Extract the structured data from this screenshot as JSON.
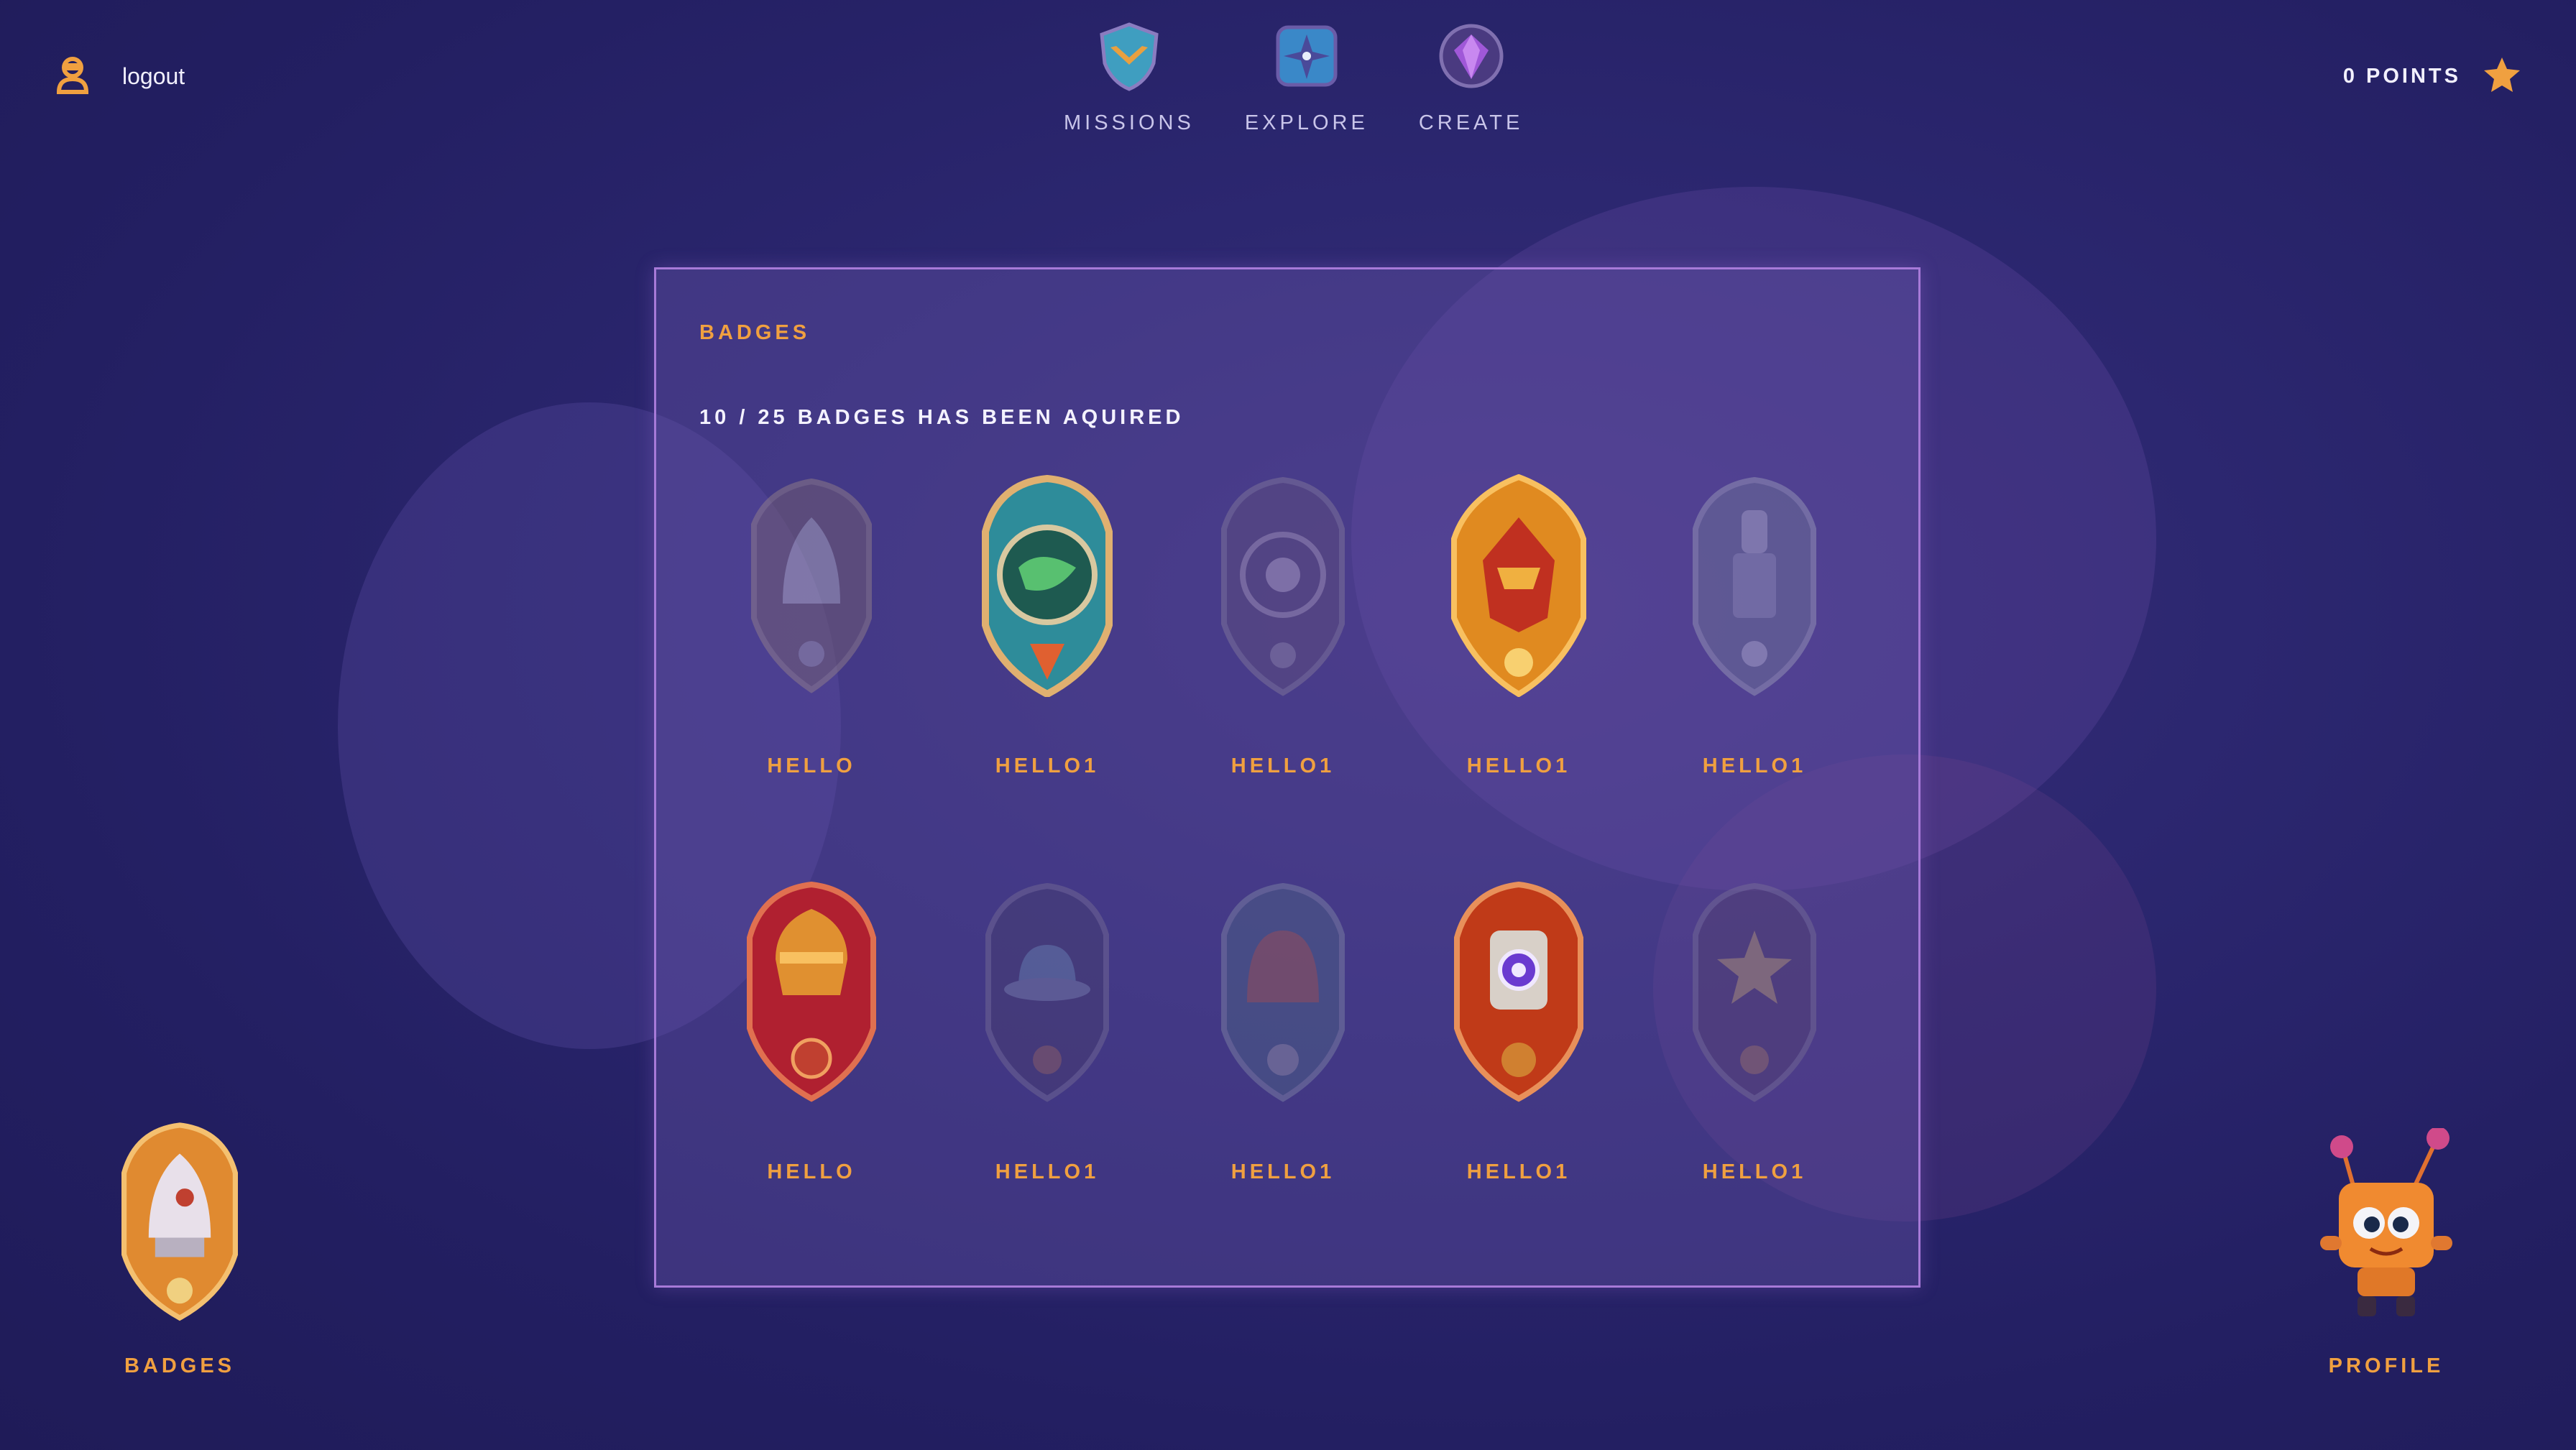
{
  "header": {
    "logout_label": "logout",
    "nav": [
      {
        "label": "MISSIONS",
        "icon": "shield-wings-icon"
      },
      {
        "label": "EXPLORE",
        "icon": "compass-star-icon"
      },
      {
        "label": "CREATE",
        "icon": "gem-icon"
      }
    ],
    "points_label": "0 POINTS"
  },
  "badges_panel": {
    "title": "BADGES",
    "summary": "10 / 25 BADGES HAS BEEN AQUIRED",
    "badges": [
      {
        "label": "HELLO",
        "acquired": false,
        "icon": "rocket-badge-icon"
      },
      {
        "label": "HELLO1",
        "acquired": true,
        "icon": "planet-badge-icon"
      },
      {
        "label": "HELLO1",
        "acquired": false,
        "icon": "orbit-badge-icon"
      },
      {
        "label": "HELLO1",
        "acquired": true,
        "icon": "ship-badge-icon"
      },
      {
        "label": "HELLO1",
        "acquired": false,
        "icon": "tower-badge-icon"
      },
      {
        "label": "HELLO",
        "acquired": true,
        "icon": "helmet-badge-icon"
      },
      {
        "label": "HELLO1",
        "acquired": false,
        "icon": "ufo-badge-icon"
      },
      {
        "label": "HELLO1",
        "acquired": false,
        "icon": "dome-badge-icon"
      },
      {
        "label": "HELLO1",
        "acquired": true,
        "icon": "robot-badge-icon"
      },
      {
        "label": "HELLO1",
        "acquired": false,
        "icon": "star-badge-icon"
      }
    ]
  },
  "footer": {
    "badges_label": "BADGES",
    "profile_label": "PROFILE"
  },
  "colors": {
    "accent": "#f0a040",
    "background": "#231f62",
    "panel_border": "#a77ad8"
  }
}
